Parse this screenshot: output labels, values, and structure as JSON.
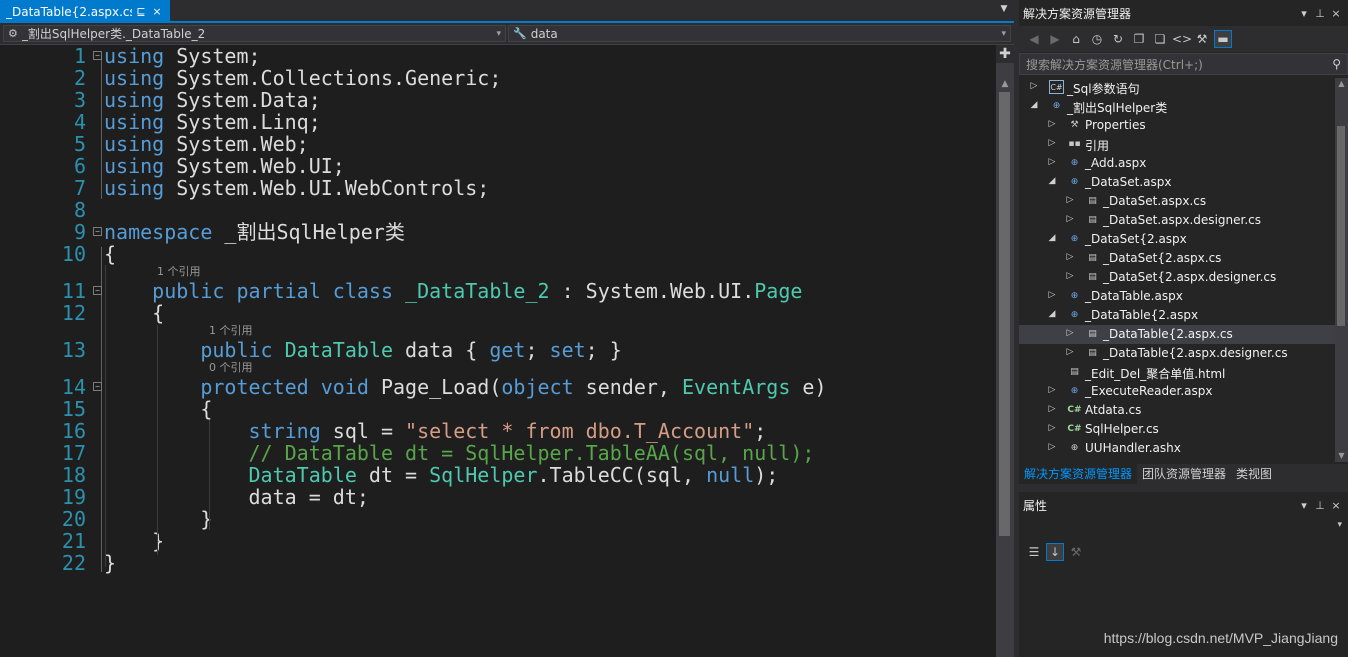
{
  "editor": {
    "tab_label": "_DataTable{2.aspx.cs",
    "tab_pin": "⊑",
    "tab_close": "×",
    "tab_dropdown": "▼",
    "nav_class": "_割出SqlHelper类._DataTable_2",
    "nav_member": "data",
    "code_lines": [
      {
        "n": "1",
        "tokens": [
          [
            "kw",
            "using"
          ],
          [
            "pl",
            " System;"
          ]
        ]
      },
      {
        "n": "2",
        "tokens": [
          [
            "kw",
            "using"
          ],
          [
            "pl",
            " System.Collections.Generic;"
          ]
        ]
      },
      {
        "n": "3",
        "tokens": [
          [
            "kw",
            "using"
          ],
          [
            "pl",
            " System.Data;"
          ]
        ]
      },
      {
        "n": "4",
        "tokens": [
          [
            "kw",
            "using"
          ],
          [
            "pl",
            " System.Linq;"
          ]
        ]
      },
      {
        "n": "5",
        "tokens": [
          [
            "kw",
            "using"
          ],
          [
            "pl",
            " System.Web;"
          ]
        ]
      },
      {
        "n": "6",
        "tokens": [
          [
            "kw",
            "using"
          ],
          [
            "pl",
            " System.Web.UI;"
          ]
        ]
      },
      {
        "n": "7",
        "tokens": [
          [
            "kw",
            "using"
          ],
          [
            "pl",
            " System.Web.UI.WebControls;"
          ]
        ]
      },
      {
        "n": "8",
        "tokens": []
      },
      {
        "n": "9",
        "tokens": [
          [
            "kw",
            "namespace"
          ],
          [
            "pl",
            " _割出SqlHelper类"
          ]
        ]
      },
      {
        "n": "10",
        "tokens": [
          [
            "pl",
            "{"
          ]
        ]
      },
      {
        "n": "11",
        "lens": "1 个引用",
        "tokens": [
          [
            "kw",
            "    public partial class"
          ],
          [
            "pl",
            " "
          ],
          [
            "ty",
            "_DataTable_2"
          ],
          [
            "pl",
            " : System.Web.UI."
          ],
          [
            "ty",
            "Page"
          ]
        ]
      },
      {
        "n": "12",
        "tokens": [
          [
            "pl",
            "    {"
          ]
        ]
      },
      {
        "n": "13",
        "lens": "1 个引用",
        "tokens": [
          [
            "kw",
            "        public"
          ],
          [
            "pl",
            " "
          ],
          [
            "ty",
            "DataTable"
          ],
          [
            "pl",
            " data { "
          ],
          [
            "kw",
            "get"
          ],
          [
            "pl",
            "; "
          ],
          [
            "kw",
            "set"
          ],
          [
            "pl",
            "; }"
          ]
        ]
      },
      {
        "n": "14",
        "lens": "0 个引用",
        "tokens": [
          [
            "kw",
            "        protected void"
          ],
          [
            "pl",
            " Page_Load("
          ],
          [
            "kw",
            "object"
          ],
          [
            "pl",
            " sender, "
          ],
          [
            "ty",
            "EventArgs"
          ],
          [
            "pl",
            " e)"
          ]
        ]
      },
      {
        "n": "15",
        "tokens": [
          [
            "pl",
            "        {"
          ]
        ]
      },
      {
        "n": "16",
        "tokens": [
          [
            "kw",
            "            string"
          ],
          [
            "pl",
            " sql = "
          ],
          [
            "st",
            "\"select * from dbo.T_Account\""
          ],
          [
            "pl",
            ";"
          ]
        ]
      },
      {
        "n": "17",
        "tokens": [
          [
            "cm",
            "            // DataTable dt = SqlHelper.TableAA(sql, null);"
          ]
        ]
      },
      {
        "n": "18",
        "tokens": [
          [
            "ty",
            "            DataTable"
          ],
          [
            "pl",
            " dt = "
          ],
          [
            "ty",
            "SqlHelper"
          ],
          [
            "pl",
            ".TableCC(sql, "
          ],
          [
            "kw",
            "null"
          ],
          [
            "pl",
            ");"
          ]
        ]
      },
      {
        "n": "19",
        "tokens": [
          [
            "pl",
            "            data = dt;"
          ]
        ]
      },
      {
        "n": "20",
        "tokens": [
          [
            "pl",
            "        }"
          ]
        ]
      },
      {
        "n": "21",
        "tokens": [
          [
            "pl",
            "    }"
          ]
        ]
      },
      {
        "n": "22",
        "tokens": [
          [
            "pl",
            "}"
          ]
        ]
      }
    ]
  },
  "solution_explorer": {
    "title": "解决方案资源管理器",
    "search_placeholder": "搜索解决方案资源管理器(Ctrl+;)",
    "items": [
      {
        "label": "_Sql参数语句",
        "icon": "csharp-project-icon",
        "arrow": "collapsed"
      },
      {
        "label": "_割出SqlHelper类",
        "icon": "web-project-icon",
        "arrow": "expanded"
      },
      {
        "label": "Properties",
        "icon": "wrench-icon",
        "arrow": "collapsed"
      },
      {
        "label": "引用",
        "icon": "references-icon",
        "arrow": "collapsed"
      },
      {
        "label": "_Add.aspx",
        "icon": "web-file-icon",
        "arrow": "collapsed"
      },
      {
        "label": "_DataSet.aspx",
        "icon": "web-file-icon",
        "arrow": "expanded"
      },
      {
        "label": "_DataSet.aspx.cs",
        "icon": "code-file-icon",
        "arrow": "collapsed"
      },
      {
        "label": "_DataSet.aspx.designer.cs",
        "icon": "code-file-icon",
        "arrow": "collapsed"
      },
      {
        "label": "_DataSet{2.aspx",
        "icon": "web-file-icon",
        "arrow": "expanded"
      },
      {
        "label": "_DataSet{2.aspx.cs",
        "icon": "code-file-icon",
        "arrow": "collapsed"
      },
      {
        "label": "_DataSet{2.aspx.designer.cs",
        "icon": "code-file-icon",
        "arrow": "collapsed"
      },
      {
        "label": "_DataTable.aspx",
        "icon": "web-file-icon",
        "arrow": "collapsed"
      },
      {
        "label": "_DataTable{2.aspx",
        "icon": "web-file-icon",
        "arrow": "expanded"
      },
      {
        "label": "_DataTable{2.aspx.cs",
        "icon": "code-file-icon",
        "arrow": "collapsed",
        "selected": true
      },
      {
        "label": "_DataTable{2.aspx.designer.cs",
        "icon": "code-file-icon",
        "arrow": "collapsed"
      },
      {
        "label": "_Edit_Del_聚合单值.html",
        "icon": "html-file-icon",
        "arrow": "none"
      },
      {
        "label": "_ExecuteReader.aspx",
        "icon": "web-file-icon",
        "arrow": "collapsed"
      },
      {
        "label": "Atdata.cs",
        "icon": "csharp-file-icon",
        "arrow": "collapsed"
      },
      {
        "label": "SqlHelper.cs",
        "icon": "csharp-file-icon",
        "arrow": "collapsed"
      },
      {
        "label": "UUHandler.ashx",
        "icon": "handler-file-icon",
        "arrow": "collapsed"
      }
    ],
    "bottom_tabs": [
      "解决方案资源管理器",
      "团队资源管理器",
      "类视图"
    ]
  },
  "properties": {
    "title": "属性"
  },
  "watermark": "https://blog.csdn.net/MVP_JiangJiang"
}
